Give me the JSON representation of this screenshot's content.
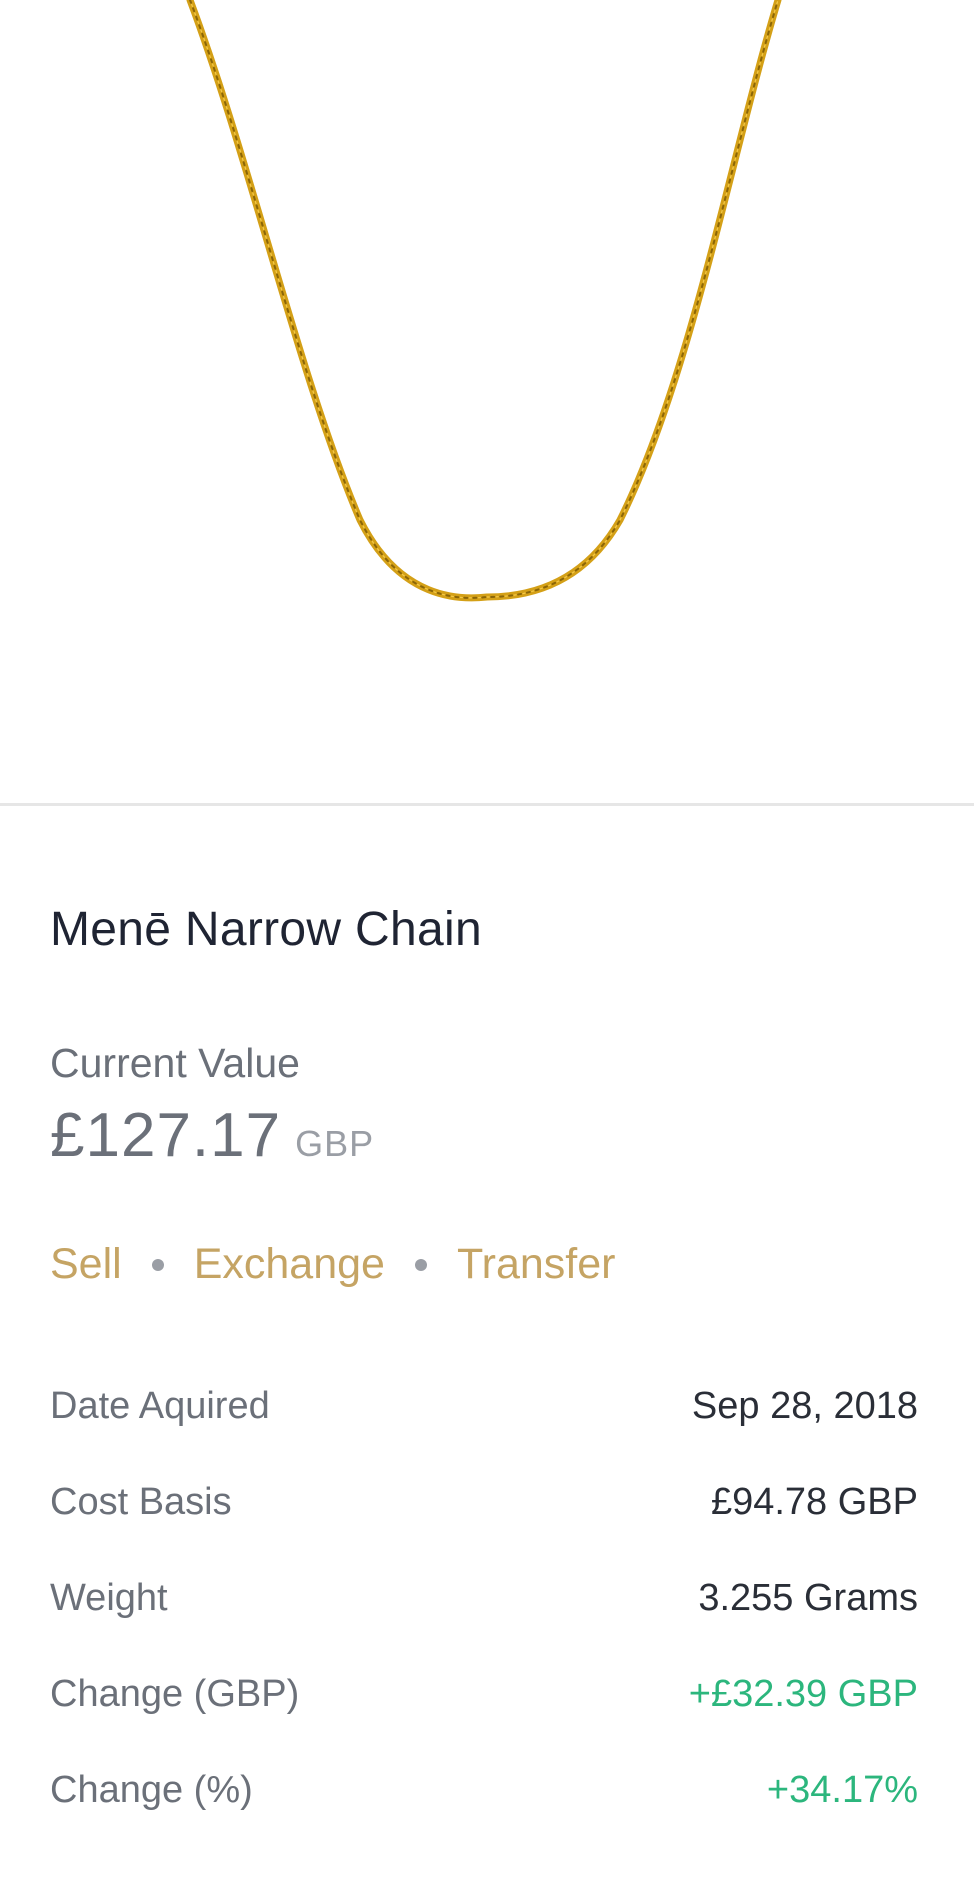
{
  "product": {
    "image_alt": "gold chain necklace",
    "name": "Menē Narrow Chain"
  },
  "current_value": {
    "label": "Current Value",
    "amount": "£127.17",
    "currency": "GBP"
  },
  "actions": {
    "sell": "Sell",
    "exchange": "Exchange",
    "transfer": "Transfer"
  },
  "details": [
    {
      "label": "Date Aquired",
      "value": "Sep 28, 2018"
    },
    {
      "label": "Cost Basis",
      "value": "£94.78 GBP"
    },
    {
      "label": "Weight",
      "value": "3.255 Grams"
    },
    {
      "label": "Change (GBP)",
      "value": "+£32.39 GBP"
    },
    {
      "label": "Change (%)",
      "value": "+34.17%"
    }
  ],
  "colors": {
    "accent_gold": "#c5a464",
    "positive_green": "#2cb67d",
    "text_dark": "#1f2433",
    "text_grey": "#6b7079"
  }
}
